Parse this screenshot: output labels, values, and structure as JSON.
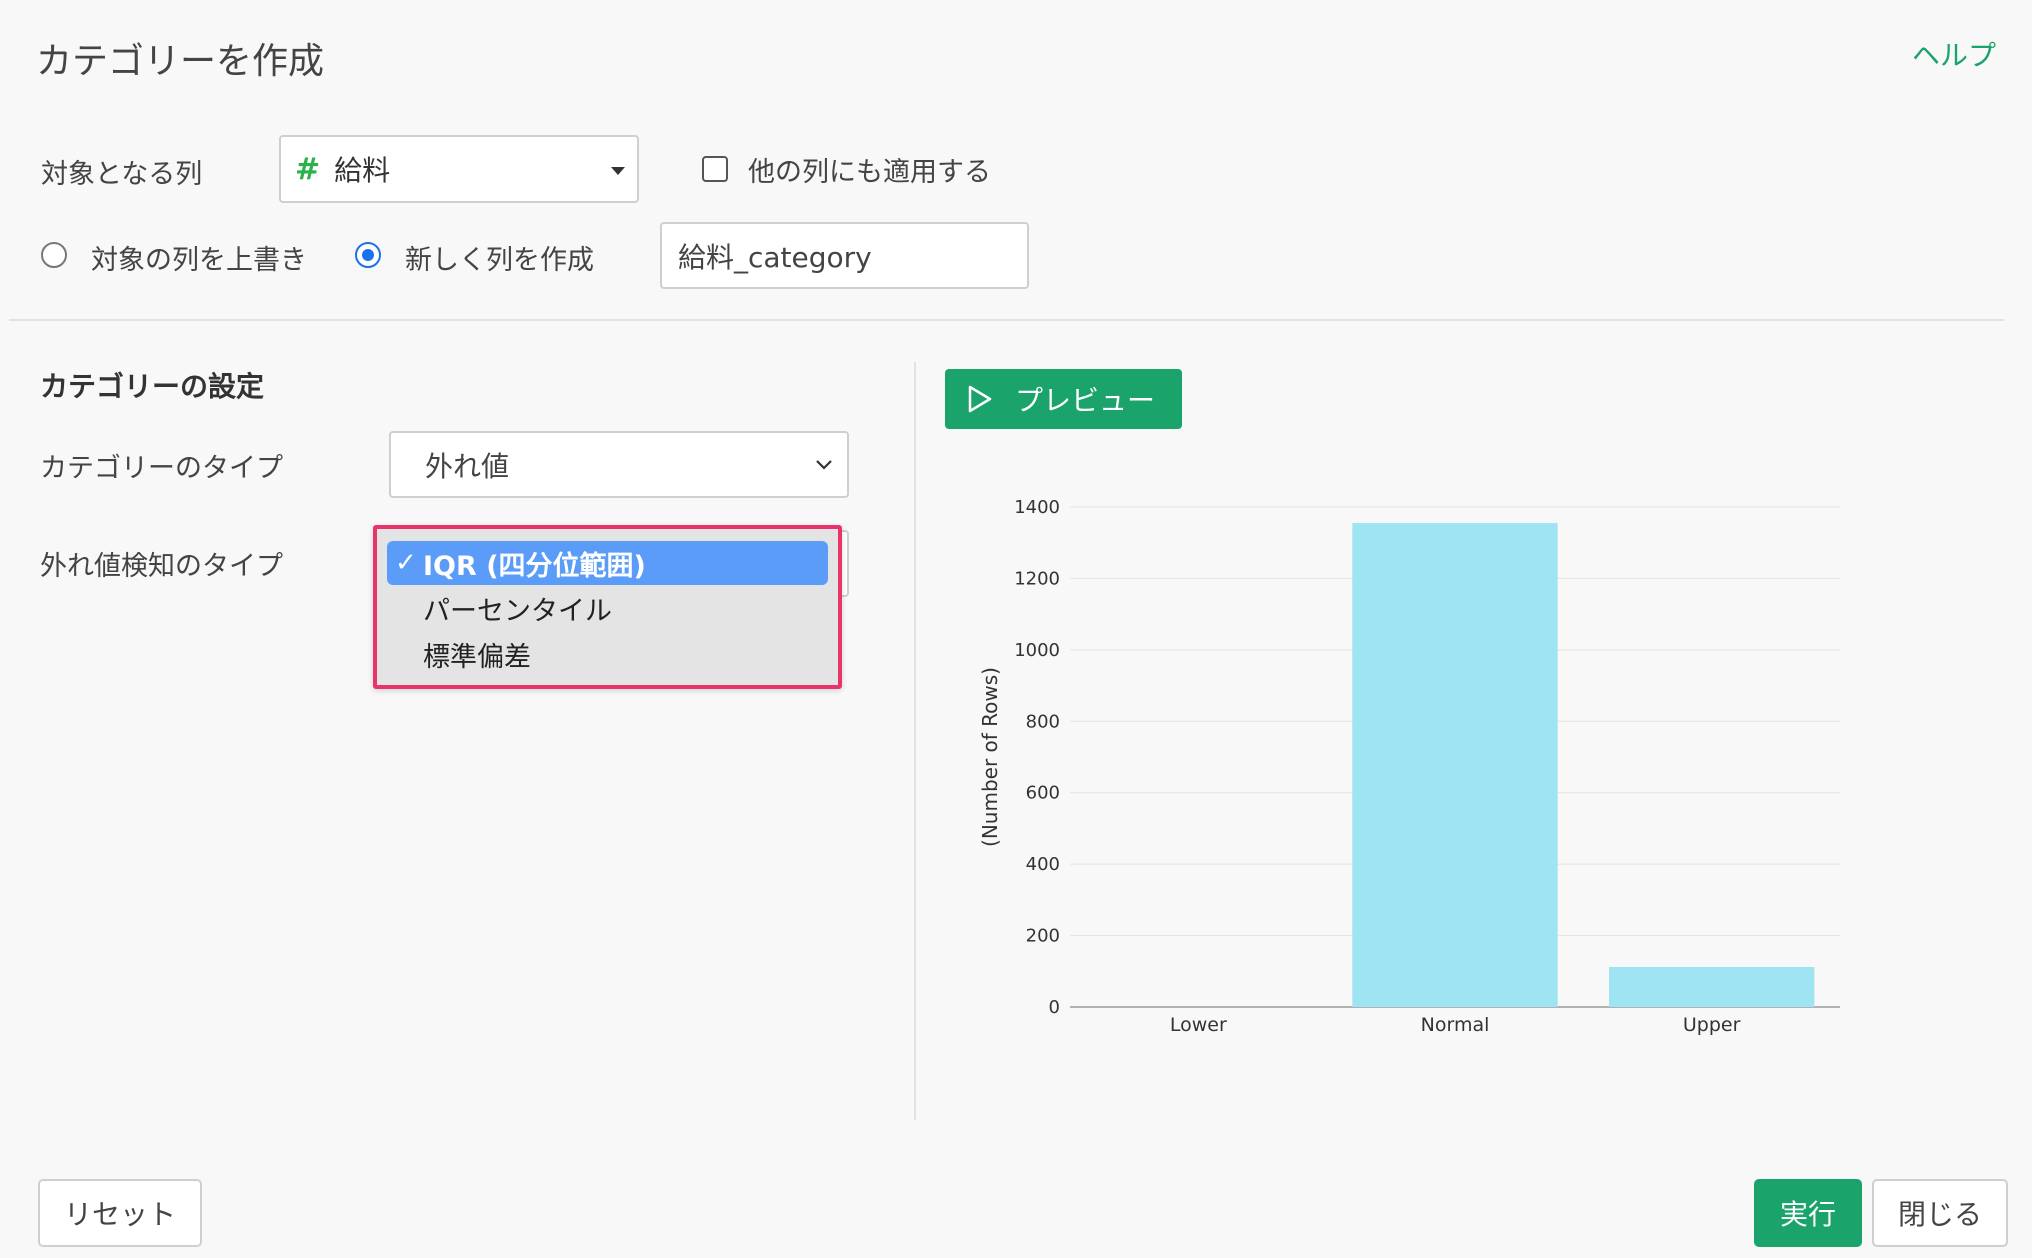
{
  "header": {
    "title": "カテゴリーを作成",
    "help_label": "ヘルプ"
  },
  "target_column": {
    "label": "対象となる列",
    "type_icon": "hash-icon",
    "value": "給料",
    "apply_other_label": "他の列にも適用する",
    "apply_other_checked": false
  },
  "output": {
    "overwrite_label": "対象の列を上書き",
    "overwrite_selected": false,
    "new_column_label": "新しく列を作成",
    "new_column_selected": true,
    "new_column_name": "給料_category"
  },
  "settings": {
    "section_title": "カテゴリーの設定",
    "category_type_label": "カテゴリーのタイプ",
    "category_type_value": "外れ値",
    "outlier_type_label": "外れ値検知のタイプ",
    "outlier_options": [
      "IQR (四分位範囲)",
      "パーセンタイル",
      "標準偏差"
    ],
    "outlier_selected": "IQR (四分位範囲)",
    "check_mark": "✓"
  },
  "preview": {
    "button_label": "プレビュー"
  },
  "colors": {
    "accent": "#1aa36b",
    "bar": "#9ee4f3",
    "highlight": "#e8336b",
    "selected": "#5a9cf8"
  },
  "chart_data": {
    "type": "bar",
    "categories": [
      "Lower",
      "Normal",
      "Upper"
    ],
    "values": [
      0,
      1355,
      112
    ],
    "ylabel": "(Number of Rows)",
    "xlabel": "",
    "ylim": [
      0,
      1400
    ],
    "yticks": [
      0,
      200,
      400,
      600,
      800,
      1000,
      1200,
      1400
    ],
    "grid": true
  },
  "footer": {
    "reset_label": "リセット",
    "run_label": "実行",
    "close_label": "閉じる"
  }
}
